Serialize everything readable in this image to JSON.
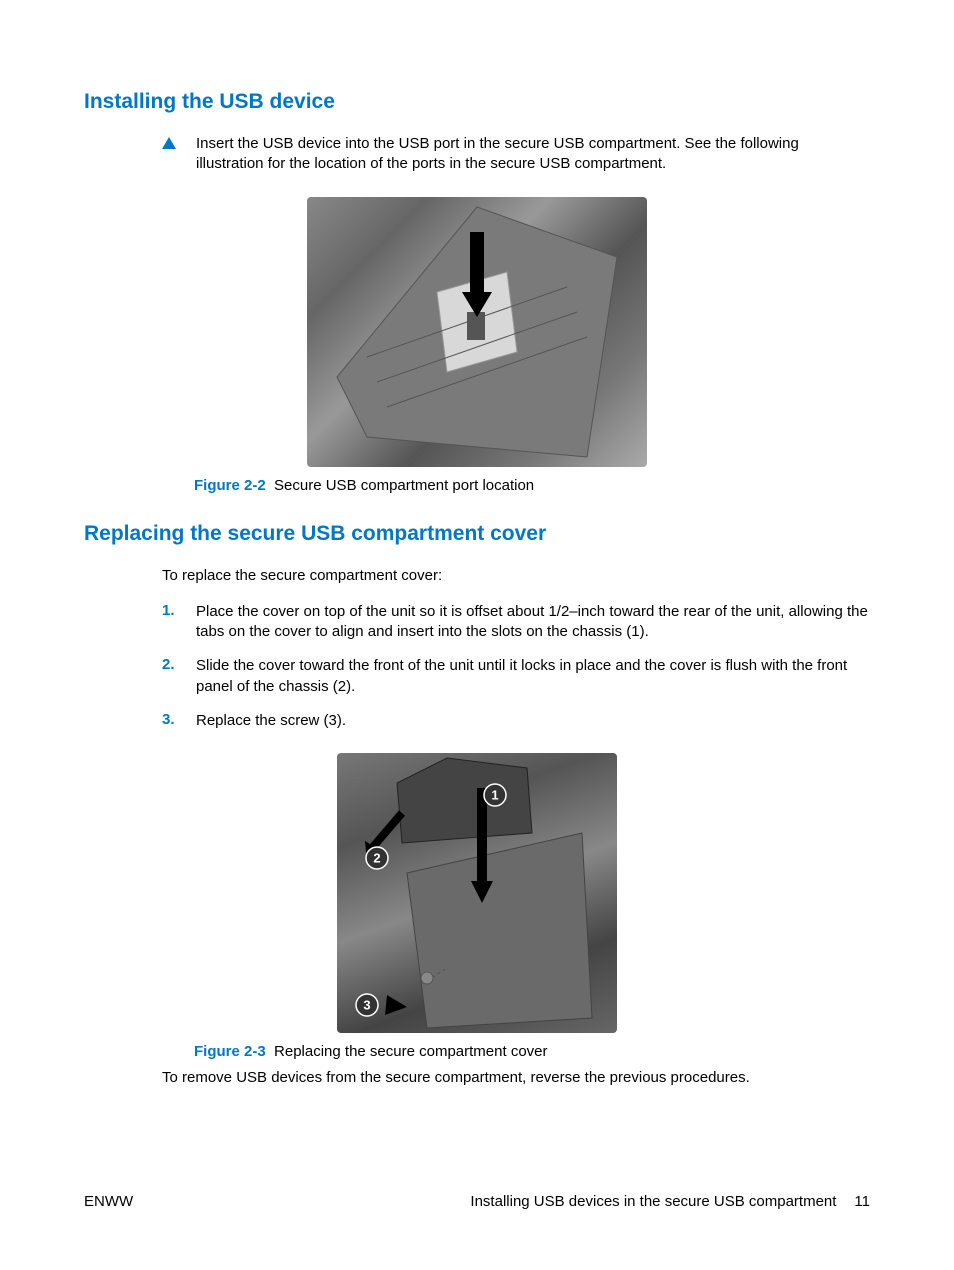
{
  "section1": {
    "heading": "Installing the USB device",
    "bullet_text": "Insert the USB device into the USB port in the secure USB compartment. See the following illustration for the location of the ports in the secure USB compartment.",
    "figure": {
      "label": "Figure 2-2",
      "caption": "Secure USB compartment port location"
    }
  },
  "section2": {
    "heading": "Replacing the secure USB compartment cover",
    "intro": "To replace the secure compartment cover:",
    "steps": [
      {
        "num": "1.",
        "text": "Place the cover on top of the unit so it is offset about 1/2–inch toward the rear of the unit, allowing the tabs on the cover to align and insert into the slots on the chassis (1)."
      },
      {
        "num": "2.",
        "text": "Slide the cover toward the front of the unit until it locks in place and the cover is flush with the front panel of the chassis (2)."
      },
      {
        "num": "3.",
        "text": "Replace the screw (3)."
      }
    ],
    "figure": {
      "label": "Figure 2-3",
      "caption": "Replacing the secure compartment cover",
      "callouts": [
        "1",
        "2",
        "3"
      ]
    },
    "closing": "To remove USB devices from the secure compartment, reverse the previous procedures."
  },
  "footer": {
    "left": "ENWW",
    "right_text": "Installing USB devices in the secure USB compartment",
    "page_number": "11"
  }
}
